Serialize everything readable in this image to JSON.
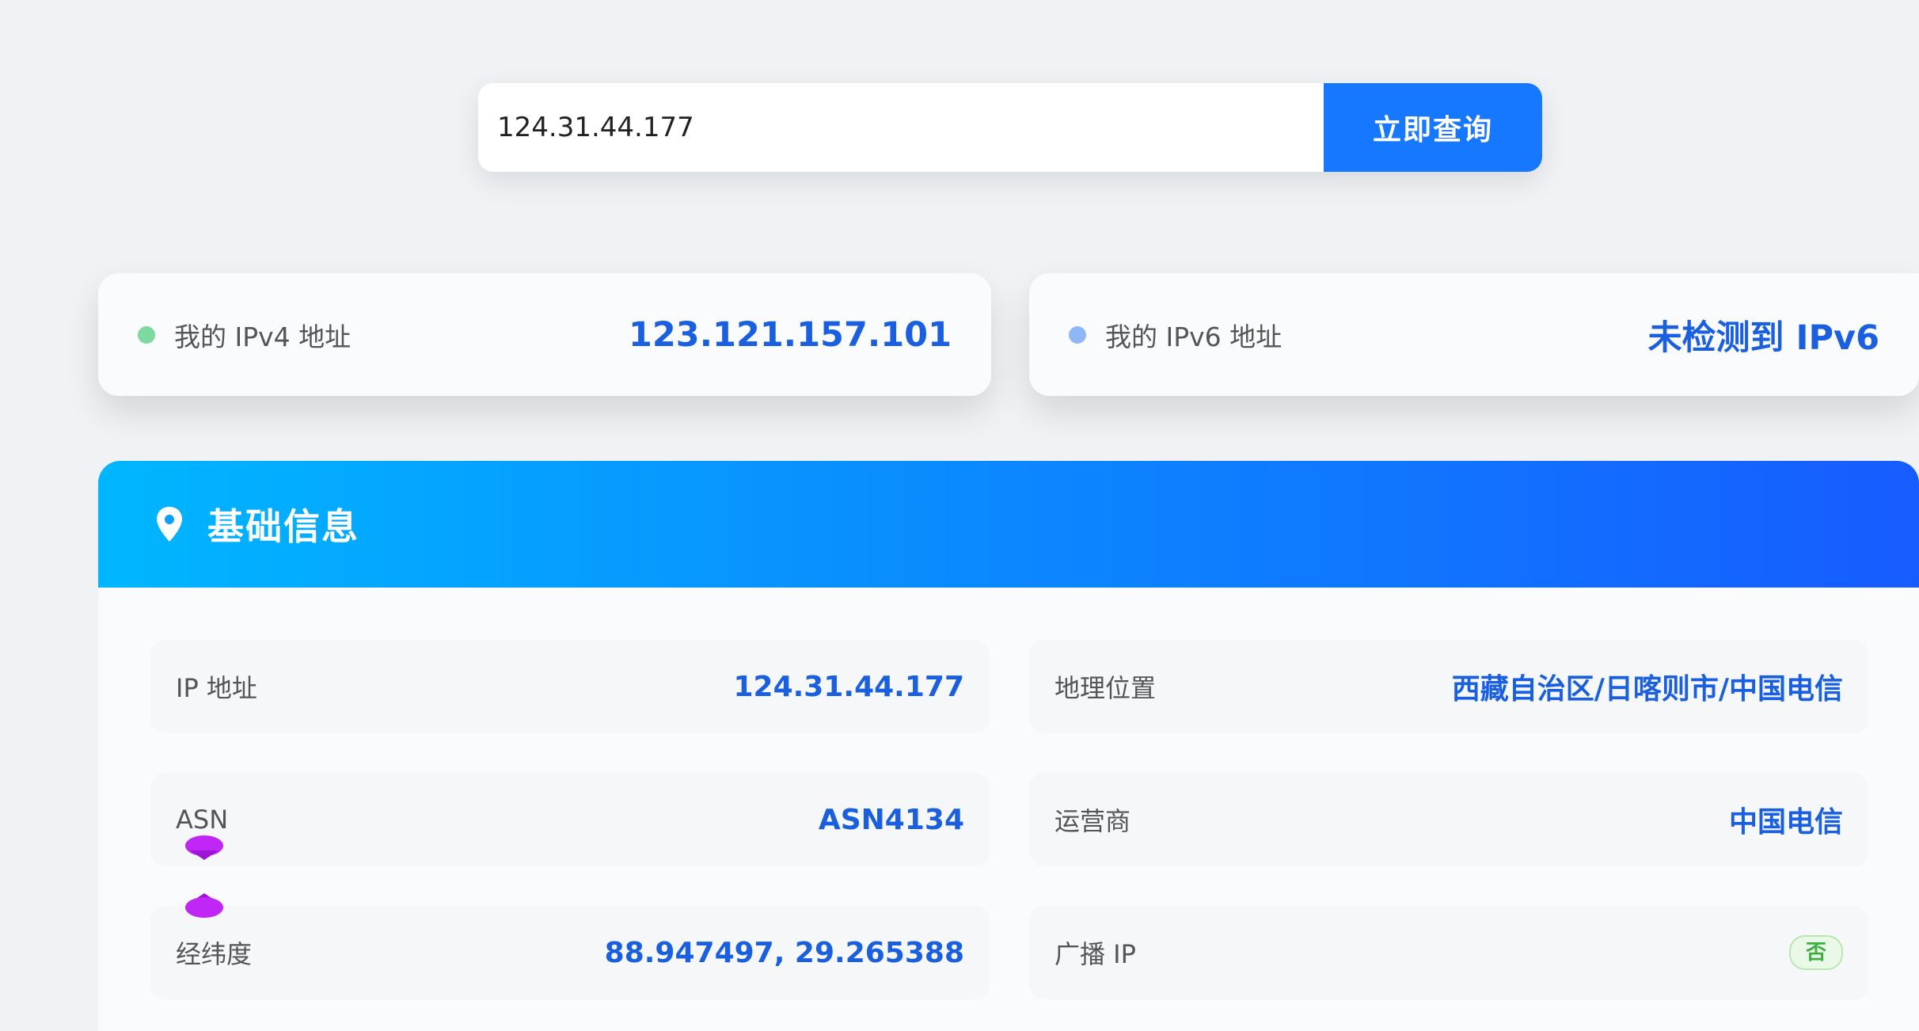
{
  "search": {
    "value": "124.31.44.177",
    "button_label": "立即查询"
  },
  "my_ip": {
    "ipv4": {
      "label": "我的 IPv4 地址",
      "value": "123.121.157.101",
      "dot_color": "#7ed9a0"
    },
    "ipv6": {
      "label": "我的 IPv6 地址",
      "value": "未检测到 IPv6",
      "dot_color": "#8fb6f5"
    }
  },
  "basic_info": {
    "title": "基础信息",
    "icon": "map-pin-icon",
    "fields": {
      "ip": {
        "label": "IP 地址",
        "value": "124.31.44.177"
      },
      "location": {
        "label": "地理位置",
        "value": "西藏自治区/日喀则市/中国电信"
      },
      "asn": {
        "label": "ASN",
        "value": "ASN4134"
      },
      "isp": {
        "label": "运营商",
        "value": "中国电信"
      },
      "coords": {
        "label": "经纬度",
        "value": "88.947497, 29.265388"
      },
      "broadcast": {
        "label": "广播 IP",
        "value": "否"
      }
    }
  },
  "colors": {
    "accent": "#1677ff",
    "value_text": "#1a5fe0",
    "header_gradient_start": "#00b6ff",
    "header_gradient_end": "#175cff",
    "badge_green": "#3bb041",
    "decor_purple": "#c026f5"
  }
}
